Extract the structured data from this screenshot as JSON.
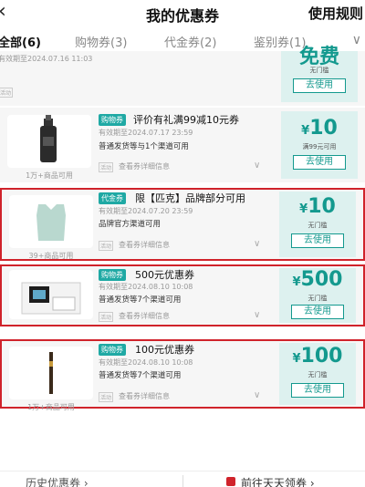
{
  "header": {
    "back_glyph": "‹",
    "title": "我的优惠券",
    "rules": "使用规则"
  },
  "tabs": [
    {
      "label": "全部(6)",
      "active": true
    },
    {
      "label": "购物券(3)",
      "active": false
    },
    {
      "label": "代金券(2)",
      "active": false
    },
    {
      "label": "鉴别券(1)",
      "active": false
    }
  ],
  "tabs_more_glyph": "∨",
  "top_partial": {
    "valid": "有效期至2024.07.16 11:03",
    "tag": "活动",
    "amount": "免费",
    "cond": "无门槛",
    "button": "去使用"
  },
  "coupons": [
    {
      "badge": "购物券",
      "name": "评价有礼满99减10元券",
      "valid": "有效期至2024.07.17 23:59",
      "scope": "普通发货等与1个渠道可用",
      "thumb_caption": "1万+商品可用",
      "tag": "活动",
      "detail": "查看券详细信息",
      "currency": "¥",
      "amount": "10",
      "cond": "满99元可用",
      "button": "去使用"
    },
    {
      "badge": "代金券",
      "name": "限【匹克】品牌部分可用",
      "valid": "有效期至2024.07.20 23:59",
      "scope": "品牌官方渠道可用",
      "thumb_caption": "39+商品可用",
      "tag": "活动",
      "detail": "查看券详细信息",
      "currency": "¥",
      "amount": "10",
      "cond": "无门槛",
      "button": "去使用"
    },
    {
      "badge": "购物券",
      "name": "500元优惠券",
      "valid": "有效期至2024.08.10 10:08",
      "scope": "普通发货等7个渠道可用",
      "thumb_caption": "1万+商品可用",
      "tag": "活动",
      "detail": "查看券详细信息",
      "currency": "¥",
      "amount": "500",
      "cond": "无门槛",
      "button": "去使用"
    },
    {
      "badge": "购物券",
      "name": "100元优惠券",
      "valid": "有效期至2024.08.10 10:08",
      "scope": "普通发货等7个渠道可用",
      "thumb_caption": "1万+商品可用",
      "tag": "活动",
      "detail": "查看券详细信息",
      "currency": "¥",
      "amount": "100",
      "cond": "无门槛",
      "button": "去使用"
    }
  ],
  "chevron_glyph": "∨",
  "bottom": {
    "history": "历史优惠券 ›",
    "go": "前往天天领券 ›"
  },
  "colors": {
    "accent": "#13998e",
    "badge": "#1fa9a4",
    "highlight_border": "#d0232b"
  }
}
